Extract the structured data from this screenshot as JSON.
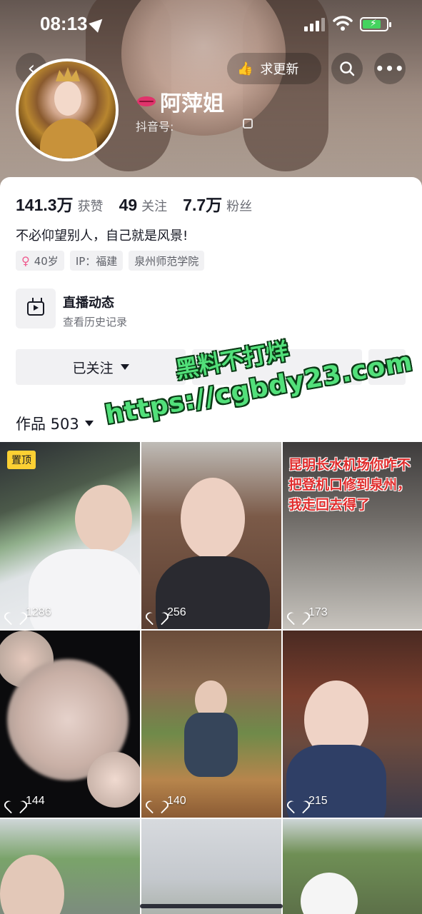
{
  "status_bar": {
    "time": "08:13"
  },
  "header": {
    "request_update_label": "求更新",
    "nickname": "阿萍姐",
    "douyin_id_label": "抖音号:"
  },
  "stats": [
    {
      "value": "141.3万",
      "label": "获赞"
    },
    {
      "value": "49",
      "label": "关注"
    },
    {
      "value": "7.7万",
      "label": "粉丝"
    }
  ],
  "bio": "不必仰望别人，自己就是风景!",
  "tags": {
    "age": "40岁",
    "ip": "IP：福建",
    "school": "泉州师范学院"
  },
  "live": {
    "title": "直播动态",
    "subtitle": "查看历史记录"
  },
  "actions": {
    "follow_label": "已关注"
  },
  "works": {
    "label": "作品 503"
  },
  "watermark": {
    "line1": "黑料不打烊",
    "line2": "https://cgbdy23.com"
  },
  "videos": [
    {
      "likes": "1286",
      "pinned_label": "置顶",
      "overlay_text": ""
    },
    {
      "likes": "256",
      "overlay_text": ""
    },
    {
      "likes": "173",
      "overlay_text": "昆明长水机场你咋不把登机口修到泉州，我走回去得了"
    },
    {
      "likes": "144",
      "overlay_text": ""
    },
    {
      "likes": "140",
      "overlay_text": ""
    },
    {
      "likes": "215",
      "overlay_text": ""
    }
  ],
  "colors": {
    "accent_green": "#52e07a",
    "pin_yellow": "#fcd033",
    "overlay_red": "#e02d2d"
  }
}
